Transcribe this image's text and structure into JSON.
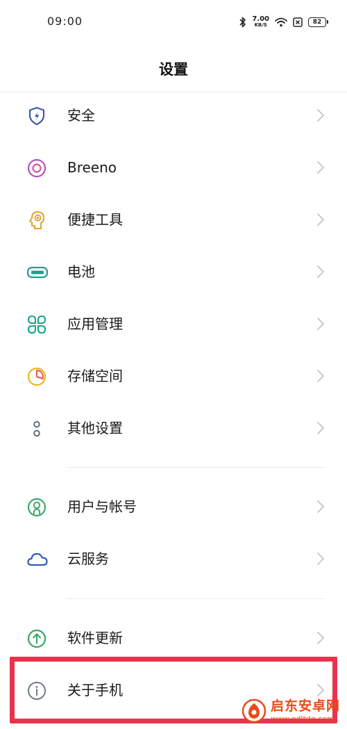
{
  "status_bar": {
    "time": "09:00",
    "net_speed": "7.00",
    "net_unit": "KB/S",
    "battery": "82"
  },
  "title": "设置",
  "groups": [
    {
      "items": [
        {
          "label": "安全",
          "icon": "security-shield-icon"
        },
        {
          "label": "Breeno",
          "icon": "breeno-icon"
        },
        {
          "label": "便捷工具",
          "icon": "convenience-tools-icon"
        },
        {
          "label": "电池",
          "icon": "battery-icon"
        },
        {
          "label": "应用管理",
          "icon": "app-management-icon"
        },
        {
          "label": "存储空间",
          "icon": "storage-icon"
        },
        {
          "label": "其他设置",
          "icon": "other-settings-icon"
        }
      ]
    },
    {
      "items": [
        {
          "label": "用户与帐号",
          "icon": "user-account-icon"
        },
        {
          "label": "云服务",
          "icon": "cloud-service-icon"
        }
      ]
    },
    {
      "items": [
        {
          "label": "软件更新",
          "icon": "software-update-icon"
        },
        {
          "label": "关于手机",
          "icon": "about-phone-icon"
        }
      ]
    }
  ],
  "highlighted_item": "关于手机",
  "watermark": {
    "name": "启东安卓网",
    "url": "www.qdltdq.com"
  },
  "colors": {
    "highlight": "#e8324f",
    "shield": "#3b5aa8",
    "breeno": "#b053c9",
    "tools": "#e0a530",
    "battery": "#18a38a",
    "apps": "#17a48e",
    "storage": "#f0b31c",
    "other": "#5b6a78",
    "user": "#3ea86a",
    "cloud": "#2d5fb5",
    "update": "#3aa360",
    "about": "#6b7b8c",
    "watermark": "#e94a1b"
  }
}
